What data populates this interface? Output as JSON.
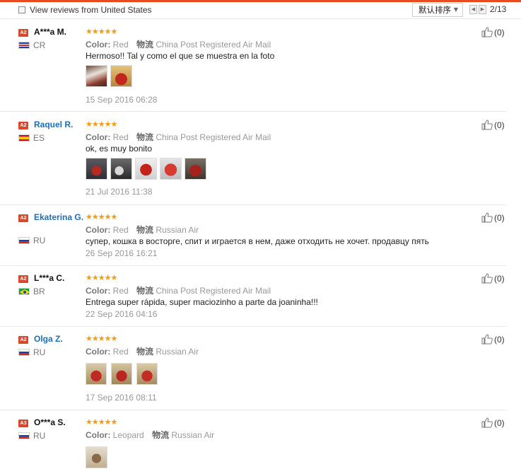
{
  "toolbar": {
    "filter_label": "View reviews from United States",
    "sort_label": "默认排序",
    "page": "2/13"
  },
  "colors": {
    "accent": "#e84c1e",
    "star": "#f39c12",
    "link": "#1c6fb5",
    "level_badge": "#d9482b"
  },
  "labels": {
    "color": "Color:",
    "logistics": "物流"
  },
  "reviews": [
    {
      "level": "A2",
      "name": "A***a M.",
      "country": "CR",
      "flag": "costa-rica-flag",
      "stars": "★★★★★",
      "color": "Red",
      "shipping": "China Post Registered Air Mail",
      "text": "Hermoso!! Tal y como el que se muestra en la foto",
      "date": "15 Sep 2016 06:28",
      "helpful": "(0)",
      "photos": 2
    },
    {
      "level": "A2",
      "name": "Raquel R.",
      "country": "ES",
      "flag": "spain-flag",
      "stars": "★★★★★",
      "color": "Red",
      "shipping": "China Post Registered Air Mail",
      "text": "ok, es muy bonito",
      "date": "21 Jul 2016 11:38",
      "helpful": "(0)",
      "photos": 5
    },
    {
      "level": "A2",
      "name": "Ekaterina G.",
      "country": "RU",
      "flag": "russia-flag",
      "stars": "★★★★★",
      "color": "Red",
      "shipping": "Russian Air",
      "text": "супер, кошка в восторге, спит и играется в нем, даже отходить не хочет. продавцу пять",
      "date": "26 Sep 2016 16:21",
      "helpful": "(0)",
      "photos": 0
    },
    {
      "level": "A2",
      "name": "L***a C.",
      "country": "BR",
      "flag": "brazil-flag",
      "stars": "★★★★★",
      "color": "Red",
      "shipping": "China Post Registered Air Mail",
      "text": "Entrega super rápida, super maciozinho a parte da joaninha!!!",
      "date": "22 Sep 2016 04:16",
      "helpful": "(0)",
      "photos": 0
    },
    {
      "level": "A2",
      "name": "Olga Z.",
      "country": "RU",
      "flag": "russia-flag",
      "stars": "★★★★★",
      "color": "Red",
      "shipping": "Russian Air",
      "text": "",
      "date": "17 Sep 2016 08:11",
      "helpful": "(0)",
      "photos": 3
    },
    {
      "level": "A3",
      "name": "O***a S.",
      "country": "RU",
      "flag": "russia-flag",
      "stars": "★★★★★",
      "color": "Leopard",
      "shipping": "Russian Air",
      "text": "",
      "date": "",
      "helpful": "(0)",
      "photos": 1
    }
  ]
}
